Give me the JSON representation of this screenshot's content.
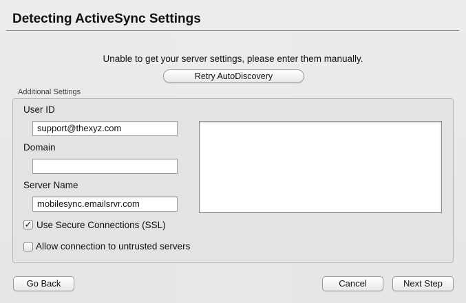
{
  "dialog": {
    "title": "Detecting ActiveSync Settings",
    "message": "Unable to get your server settings, please enter them manually.",
    "retry_label": "Retry AutoDiscovery"
  },
  "additional": {
    "group_label": "Additional Settings",
    "user_id_label": "User ID",
    "user_id_value": "support@thexyz.com",
    "domain_label": "Domain",
    "domain_value": "",
    "server_name_label": "Server Name",
    "server_name_value": "mobilesync.emailsrvr.com",
    "ssl_label": "Use Secure Connections (SSL)",
    "ssl_checked": true,
    "untrusted_label": "Allow connection to untrusted servers",
    "untrusted_checked": false
  },
  "footer": {
    "go_back_label": "Go Back",
    "cancel_label": "Cancel",
    "next_step_label": "Next Step"
  }
}
